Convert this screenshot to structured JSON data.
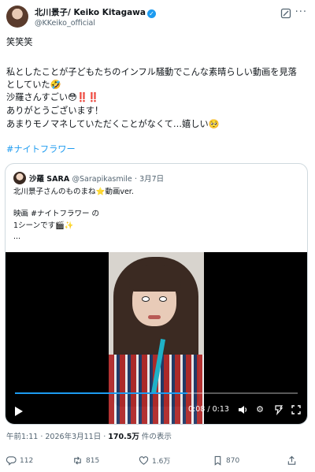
{
  "author": {
    "display_name": "北川景子/ Keiko Kitagawa",
    "handle": "@KKeiko_official"
  },
  "post": {
    "lines": [
      "笑笑笑",
      "私としたことが子どもたちのインフル騒動でこんな素晴らしい動画を見落",
      "としていた🤣",
      "沙羅さんすごい😳‼️‼️",
      "ありがとうございます！",
      "あまりモノマネしていただくことがなくて…嬉しい🥺"
    ],
    "hashtag": "#ナイトフラワー"
  },
  "quote": {
    "name": "沙羅 SARA",
    "handle": "@Sarapikasmile",
    "date": "· 3月7日",
    "lines": [
      "北川景子さんのものまね⭐️動画ver.",
      "映画 #ナイトフラワー の",
      "1シーンです🎬✨",
      "..."
    ],
    "video": {
      "time": "0:08 / 0:13",
      "progress": 0.61
    }
  },
  "meta": {
    "time": "午前1:11 · 2026年3月11日 · ",
    "views_count": "170.5万",
    "views_label": " 件の表示"
  },
  "actions": {
    "replies": "112",
    "reposts": "815",
    "likes": "1.6万",
    "bookmarks": "870"
  },
  "icons": [
    "verified-icon",
    "grok-icon",
    "more-icon",
    "play-icon",
    "volume-icon",
    "settings-icon",
    "captions-icon",
    "fullscreen-icon",
    "reply-icon",
    "repost-icon",
    "like-icon",
    "bookmark-icon",
    "share-icon"
  ],
  "colors": {
    "accent": "#1d9bf0",
    "muted": "#536471",
    "text": "#0f1419",
    "border": "#cfd9de"
  }
}
